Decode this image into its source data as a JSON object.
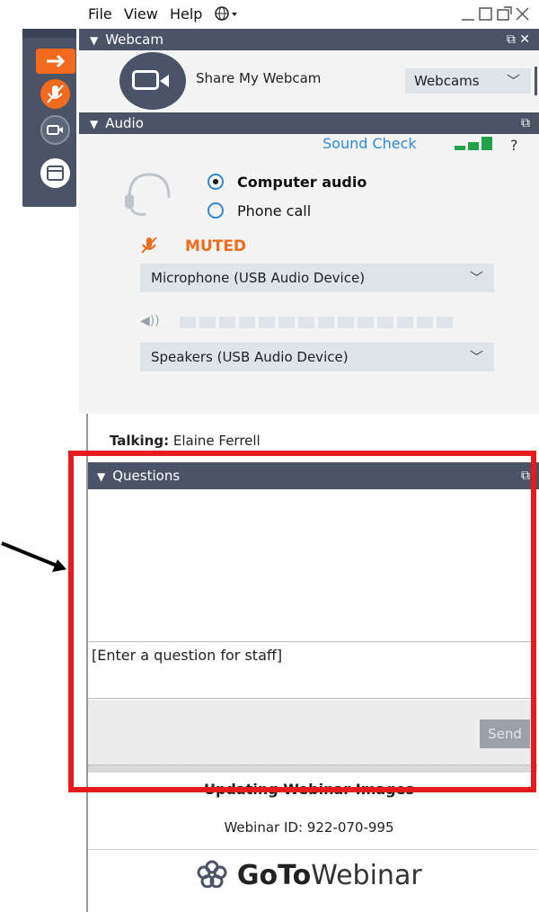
{
  "menu": {
    "items": [
      "File",
      "View",
      "Help"
    ],
    "globe_icon": "globe-icon"
  },
  "window_controls": {
    "icons": [
      "minimize-icon",
      "restore-icon",
      "popout-icon",
      "close-icon"
    ]
  },
  "toolbar": {
    "icons": [
      "exit-arrow-icon",
      "mic-muted-icon",
      "webcam-icon",
      "screen-icon"
    ],
    "accent": "#f26b1d"
  },
  "webcam": {
    "header": "Webcam",
    "share_label": "Share My Webcam",
    "dropdown": "Webcams"
  },
  "audio": {
    "header": "Audio",
    "sound_check": "Sound Check",
    "help": "?",
    "options": [
      "Computer audio",
      "Phone call"
    ],
    "selected": "Computer audio",
    "muted_label": "MUTED",
    "microphone": "Microphone (USB Audio Device)",
    "speakers": "Speakers (USB Audio Device)",
    "volume_level": 0
  },
  "talking": {
    "label": "Talking:",
    "name": "Elaine Ferrell"
  },
  "questions": {
    "header": "Questions",
    "placeholder": "[Enter a question for staff]",
    "send_label": "Send"
  },
  "webinar": {
    "title": "Updating Webinar Images",
    "id_text": "Webinar ID: 922-070-995",
    "logo_bold": "GoTo",
    "logo_light": "Webinar"
  },
  "colors": {
    "header_bg": "#4b5466",
    "highlight_border": "#e61b1b",
    "link": "#2d8ad6",
    "muted": "#f26b1d"
  }
}
